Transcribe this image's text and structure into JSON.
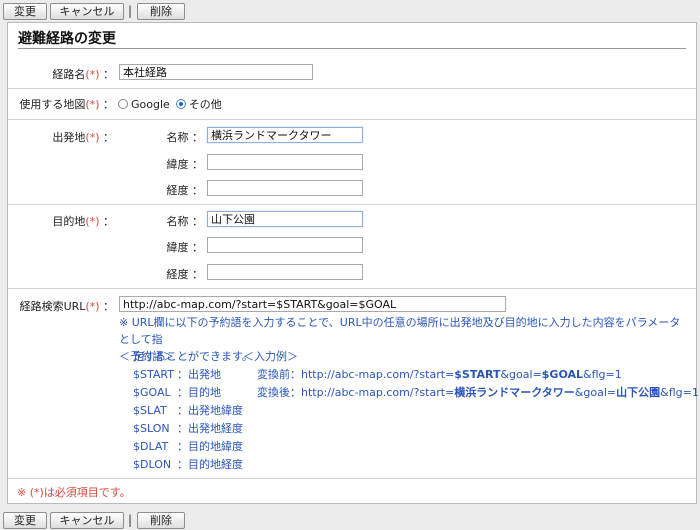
{
  "toolbar": {
    "change_label": "変更",
    "cancel_label": "キャンセル",
    "separator": "|",
    "delete_label": "削除"
  },
  "panel": {
    "title": "避難経路の変更"
  },
  "colon": "：",
  "required_mark": "(*)",
  "route_name": {
    "label": "経路名",
    "value": "本社経路"
  },
  "map_select": {
    "label": "使用する地図",
    "options": [
      {
        "label": "Google",
        "checked": false
      },
      {
        "label": "その他",
        "checked": true
      }
    ]
  },
  "departure": {
    "label": "出発地",
    "fields": [
      {
        "label": "名称",
        "value": "横浜ランドマークタワー"
      },
      {
        "label": "緯度",
        "value": ""
      },
      {
        "label": "経度",
        "value": ""
      }
    ]
  },
  "destination": {
    "label": "目的地",
    "fields": [
      {
        "label": "名称",
        "value": "山下公園"
      },
      {
        "label": "緯度",
        "value": ""
      },
      {
        "label": "経度",
        "value": ""
      }
    ]
  },
  "search_url": {
    "label": "経路検索URL",
    "value": "http://abc-map.com/?start=$START&goal=$GOAL",
    "note_line1": "※ URL欄に以下の予約語を入力することで、URL中の任意の場所に出発地及び目的地に入力した内容をパラメータとして指",
    "note_line2": "定することができます。",
    "reserved_header": "＜予約語＞",
    "reserved": [
      {
        "word": "$START",
        "desc": "：出発地"
      },
      {
        "word": "$GOAL",
        "desc": "：目的地"
      },
      {
        "word": "$SLAT",
        "desc": "：出発地緯度"
      },
      {
        "word": "$SLON",
        "desc": "：出発地経度"
      },
      {
        "word": "$DLAT",
        "desc": "：目的地緯度"
      },
      {
        "word": "$DLON",
        "desc": "：目的地経度"
      }
    ],
    "example_header": "＜入力例＞",
    "example_before": {
      "prefix": "変換前：http://abc-map.com/?start=",
      "start": "$START",
      "mid": "&goal=",
      "goal": "$GOAL",
      "suffix": "&flg=1"
    },
    "example_after": {
      "prefix": "変換後：http://abc-map.com/?start=",
      "start": "横浜ランドマークタワー",
      "mid": "&goal=",
      "goal": "山下公園",
      "suffix": "&flg=1"
    }
  },
  "footer_note": "※ (*)は必須項目です。",
  "colors": {
    "required": "#d94a3d",
    "note_blue": "#2a55b8"
  }
}
